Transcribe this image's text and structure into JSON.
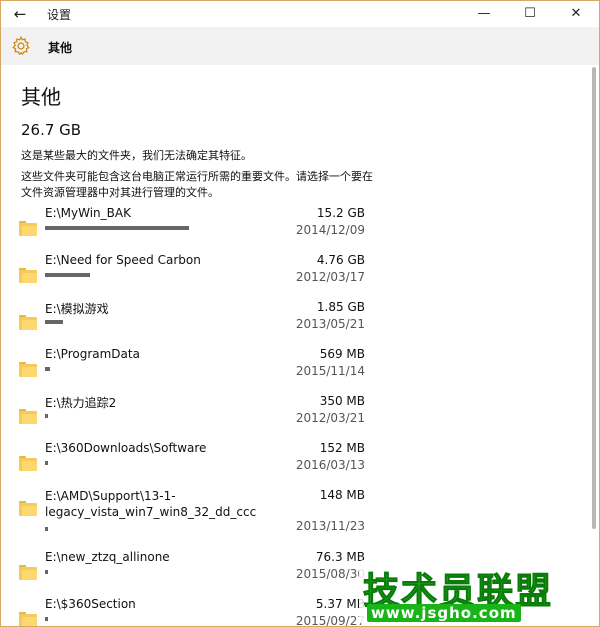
{
  "window": {
    "title": "设置",
    "back_icon": "back-arrow-icon",
    "minimize_glyph": "—",
    "maximize_glyph": "☐",
    "close_glyph": "✕"
  },
  "header": {
    "icon": "gear-icon",
    "title": "其他"
  },
  "page": {
    "title": "其他",
    "total_size": "26.7 GB",
    "description1": "这是某些最大的文件夹，我们无法确定其特征。",
    "description2": "这些文件夹可能包含这台电脑正常运行所需的重要文件。请选择一个要在文件资源管理器中对其进行管理的文件。"
  },
  "folders": [
    {
      "path": "E:\\MyWin_BAK",
      "size": "15.2 GB",
      "date": "2014/12/09",
      "share": 0.5693
    },
    {
      "path": "E:\\Need for Speed Carbon",
      "size": "4.76 GB",
      "date": "2012/03/17",
      "share": 0.1783
    },
    {
      "path": "E:\\模拟游戏",
      "size": "1.85 GB",
      "date": "2013/05/21",
      "share": 0.0693
    },
    {
      "path": "E:\\ProgramData",
      "size": "569 MB",
      "date": "2015/11/14",
      "share": 0.0208
    },
    {
      "path": "E:\\热力追踪2",
      "size": "350 MB",
      "date": "2012/03/21",
      "share": 0.0128
    },
    {
      "path": "E:\\360Downloads\\Software",
      "size": "152 MB",
      "date": "2016/03/13",
      "share": 0.0056
    },
    {
      "path": "E:\\AMD\\Support\\13-1-legacy_vista_win7_win8_32_dd_ccc",
      "size": "148 MB",
      "date": "2013/11/23",
      "share": 0.0054
    },
    {
      "path": "E:\\new_ztzq_allinone",
      "size": "76.3 MB",
      "date": "2015/08/30",
      "share": 0.0028
    },
    {
      "path": "E:\\$360Section",
      "size": "5.37 MB",
      "date": "2015/09/27",
      "share": 0.0002
    }
  ],
  "watermark": {
    "text": "技术员联盟",
    "url": "www.jsgho.com"
  }
}
